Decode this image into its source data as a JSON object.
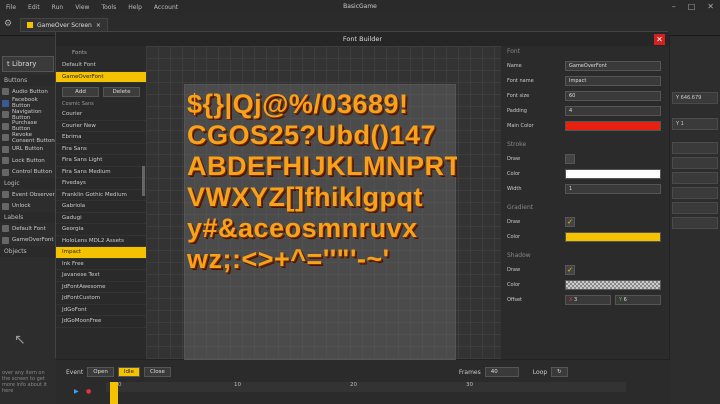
{
  "menu": [
    "File",
    "Edit",
    "Run",
    "View",
    "Tools",
    "Help",
    "Account"
  ],
  "app_title": "BasicGame",
  "tab_label": "GameOver Screen",
  "library": {
    "title": "t Library",
    "search_value": "t Library",
    "sections": [
      {
        "label": "Buttons",
        "items": [
          "Audio Button",
          "Facebook Button",
          "Navigation Button",
          "Purchase Button",
          "Revoke Consent Button",
          "URL Button",
          "Lock Button",
          "Control Button"
        ]
      },
      {
        "label": "Logic",
        "items": [
          "Event Observer",
          "Unlock"
        ]
      },
      {
        "label": "Labels",
        "items": [
          "Default Font",
          "GameOverFont"
        ]
      },
      {
        "label": "Objects",
        "items": []
      }
    ],
    "hint": "over any item on the screen to get more info about it here"
  },
  "dialog": {
    "title": "Font Builder",
    "fonts_header": "Fonts",
    "font_sets": [
      "Default Font",
      "GameOverFont"
    ],
    "add_label": "Add",
    "delete_label": "Delete",
    "font_list": [
      "Cosmic Sans",
      "Courier",
      "Courier New",
      "Ebrima",
      "Fira Sans",
      "Fira Sans Light",
      "Fira Sans Medium",
      "Fivedays",
      "Franklin Gothic Medium",
      "Gabriola",
      "Gadugi",
      "Georgia",
      "HoloLens MDL2 Assets",
      "Impact",
      "Ink Free",
      "Javanese Text",
      "JdFontAwesome",
      "JdFontCustom",
      "JdGoFont",
      "JdGoMoonFree"
    ],
    "selected_font": "Impact",
    "glyph_lines": [
      "${}|Qj@%/03689!",
      "CGOS25?Ubd()147",
      "ABDEFHIJKLMNPRT",
      "VWXYZ[]fhiklgpqt",
      "y#&aceosmnruvx",
      "wz;:<>+^=''\"'-~'",
      "_"
    ],
    "properties": {
      "font_section": "Font",
      "name_label": "Name",
      "name_value": "GameOverFont",
      "fontname_label": "Font name",
      "fontname_value": "Impact",
      "fontsize_label": "Font size",
      "fontsize_value": "60",
      "padding_label": "Padding",
      "padding_value": "4",
      "maincolor_label": "Main Color",
      "maincolor_value": "#e8200f",
      "stroke_section": "Stroke",
      "draw_label": "Draw",
      "color_label": "Color",
      "stroke_color": "#ffffff",
      "width_label": "Width",
      "width_value": "1",
      "gradient_section": "Gradient",
      "gradient_color": "#f4c200",
      "shadow_section": "Shadow",
      "offset_label": "Offset",
      "offset_x_label": "X",
      "offset_x": "3",
      "offset_y_label": "Y",
      "offset_y": "6"
    }
  },
  "right_panel": {
    "value1": "Y  646.679",
    "value2": "Y  1"
  },
  "timeline": {
    "event_label": "Event",
    "open_label": "Open",
    "idle_label": "Idle",
    "close_label": "Close",
    "frames_label": "Frames",
    "frames_value": "40",
    "loop_label": "Loop",
    "ticks": [
      "0",
      "10",
      "20",
      "30"
    ]
  },
  "colors": {
    "accent": "#f4c200",
    "close": "#d32020",
    "glyph": "#f7a21a"
  }
}
